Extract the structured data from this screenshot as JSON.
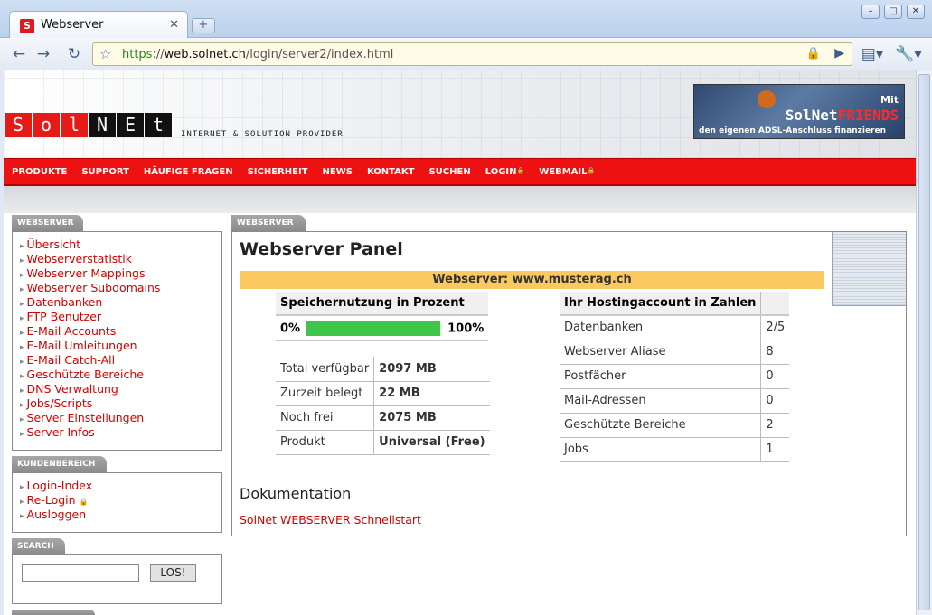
{
  "browser": {
    "tab_title": "Webserver",
    "tab_close": "✕",
    "new_tab": "+",
    "url_scheme": "https",
    "url_sep": "://",
    "url_host": "web.solnet.ch",
    "url_path": "/login/server2/index.html"
  },
  "header": {
    "logo_letters": [
      "S",
      "o",
      "l",
      "N",
      "E",
      "t"
    ],
    "tagline": "INTERNET & SOLUTION PROVIDER",
    "ad": {
      "mit": "Mit",
      "brand_plain": "SolNet",
      "brand_red": "FRIENDS",
      "sub": "den eigenen ADSL-Anschluss finanzieren"
    }
  },
  "nav": {
    "items": [
      "PRODUKTE",
      "SUPPORT",
      "HÄUFIGE FRAGEN",
      "SICHERHEIT",
      "NEWS",
      "KONTAKT",
      "SUCHEN"
    ],
    "login": "LOGIN",
    "webmail": "WEBMAIL",
    "lock_glyph": "🔒"
  },
  "sidebar": {
    "webserver_title": "WEBSERVER",
    "webserver_items": [
      "Übersicht",
      "Webserverstatistik",
      "Webserver Mappings",
      "Webserver Subdomains",
      "Datenbanken",
      "FTP Benutzer",
      "E-Mail Accounts",
      "E-Mail Umleitungen",
      "E-Mail Catch-All",
      "Geschützte Bereiche",
      "DNS Verwaltung",
      "Jobs/Scripts",
      "Server Einstellungen",
      "Server Infos"
    ],
    "kunden_title": "KUNDENBEREICH",
    "kunden_items": [
      "Login-Index",
      "Re-Login",
      "Ausloggen"
    ],
    "search_title": "SEARCH",
    "search_button": "LOS!",
    "search_value": ""
  },
  "panel": {
    "tab_label": "WEBSERVER",
    "title": "Webserver Panel",
    "server_label": "Webserver: www.musterag.ch",
    "memory": {
      "header": "Speichernutzung in Prozent",
      "min_label": "0%",
      "max_label": "100%",
      "usage_fraction": 0.99,
      "rows": [
        {
          "label": "Total verfügbar",
          "value": "2097 MB"
        },
        {
          "label": "Zurzeit belegt",
          "value": "22 MB"
        },
        {
          "label": "Noch frei",
          "value": "2075 MB"
        },
        {
          "label": "Produkt",
          "value": "Universal (Free)"
        }
      ]
    },
    "hosting": {
      "header": "Ihr Hostingaccount in Zahlen",
      "rows": [
        {
          "label": "Datenbanken",
          "value": "2/5"
        },
        {
          "label": "Webserver Aliase",
          "value": "8"
        },
        {
          "label": "Postfächer",
          "value": "0"
        },
        {
          "label": "Mail-Adressen",
          "value": "0"
        },
        {
          "label": "Geschützte Bereiche",
          "value": "2"
        },
        {
          "label": "Jobs",
          "value": "1"
        }
      ]
    },
    "doc_heading": "Dokumentation",
    "doc_link": "SolNet WEBSERVER Schnellstart"
  },
  "colors": {
    "brand_red": "#ee1111",
    "link_red": "#d40000",
    "progress_green": "#3fc54a",
    "server_bar": "#fcc860"
  }
}
